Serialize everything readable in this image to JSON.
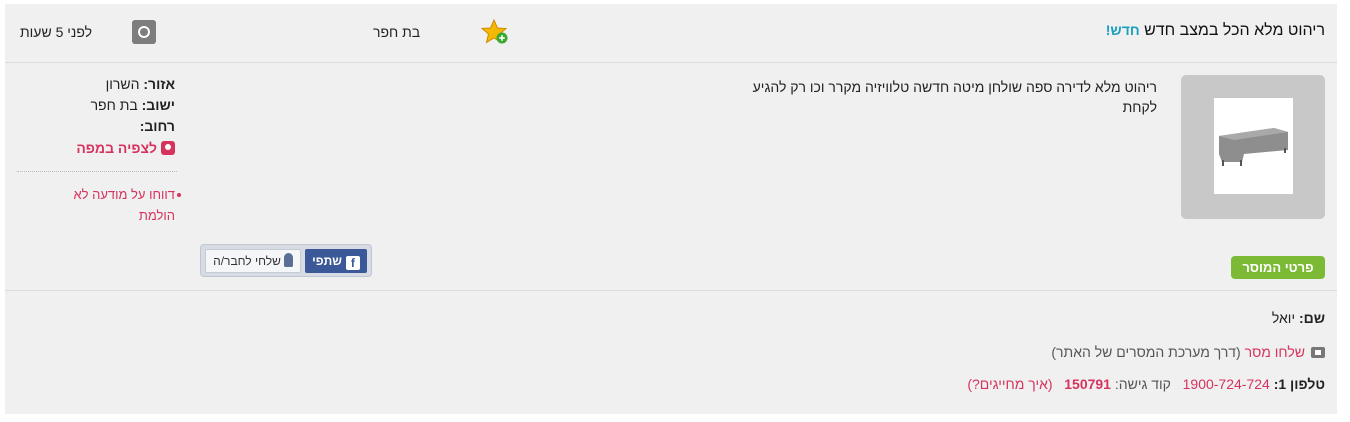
{
  "header": {
    "title": "ריהוט מלא הכל במצב חדש",
    "new_badge": "חדש!",
    "city": "בת חפר",
    "time_ago": "לפני 5 שעות"
  },
  "listing": {
    "description": "ריהוט מלא לדירה ספה שולחן מיטה חדשה טלוויזיה מקרר וכו רק להגיע לקחת",
    "seller_button": "פרטי המוסר"
  },
  "details": {
    "region_label": "אזור:",
    "region_value": "השרון",
    "settlement_label": "ישוב:",
    "settlement_value": "בת חפר",
    "street_label": "רחוב:",
    "map_link": "לצפיה במפה",
    "report_link": "דווחו על מודעה לא הולמת"
  },
  "share": {
    "facebook_label": "שתפי",
    "send_friend_label": "שלחי לחבר/ה"
  },
  "seller": {
    "name_label": "שם:",
    "name_value": "יואל",
    "message_link": "שלחו מסר",
    "message_note": "(דרך מערכת המסרים של האתר)",
    "phone_label": "טלפון 1:",
    "phone_value": "1900-724-724",
    "access_code_label": "קוד גישה:",
    "access_code_value": "150791",
    "charge_link": "(איך מחייגים?)"
  },
  "icons": {
    "favorite": "star-plus-icon",
    "time": "clock-icon",
    "map": "map-pin-icon",
    "message": "message-arrow-icon",
    "facebook": "facebook-icon",
    "person": "person-icon"
  },
  "colors": {
    "accent_pink": "#d6335e",
    "badge_blue": "#1a9fbf",
    "seller_green": "#7cb934",
    "facebook_blue": "#3b5998"
  }
}
